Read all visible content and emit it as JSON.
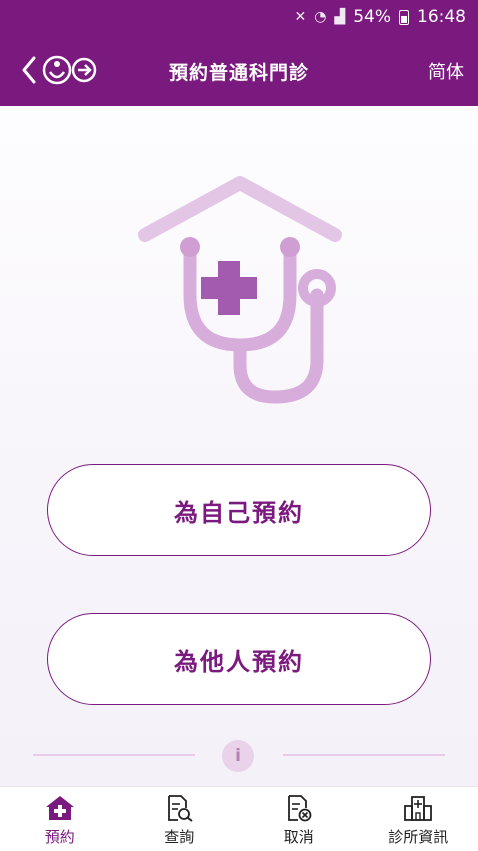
{
  "status_bar": {
    "battery": "54%",
    "time": "16:48"
  },
  "header": {
    "title": "預約普通科門診",
    "language_toggle": "简体"
  },
  "actions": {
    "self_booking": "為自己預約",
    "other_booking": "為他人預約"
  },
  "info": {
    "symbol": "i"
  },
  "bottom_nav": {
    "items": [
      {
        "label": "預約",
        "icon": "home-plus-icon",
        "active": true
      },
      {
        "label": "查詢",
        "icon": "document-search-icon",
        "active": false
      },
      {
        "label": "取消",
        "icon": "document-cancel-icon",
        "active": false
      },
      {
        "label": "診所資訊",
        "icon": "clinic-building-icon",
        "active": false
      }
    ]
  },
  "colors": {
    "brand": "#7a1a7f",
    "illustration": "#dcb4e0",
    "cross": "#a35bb0"
  }
}
